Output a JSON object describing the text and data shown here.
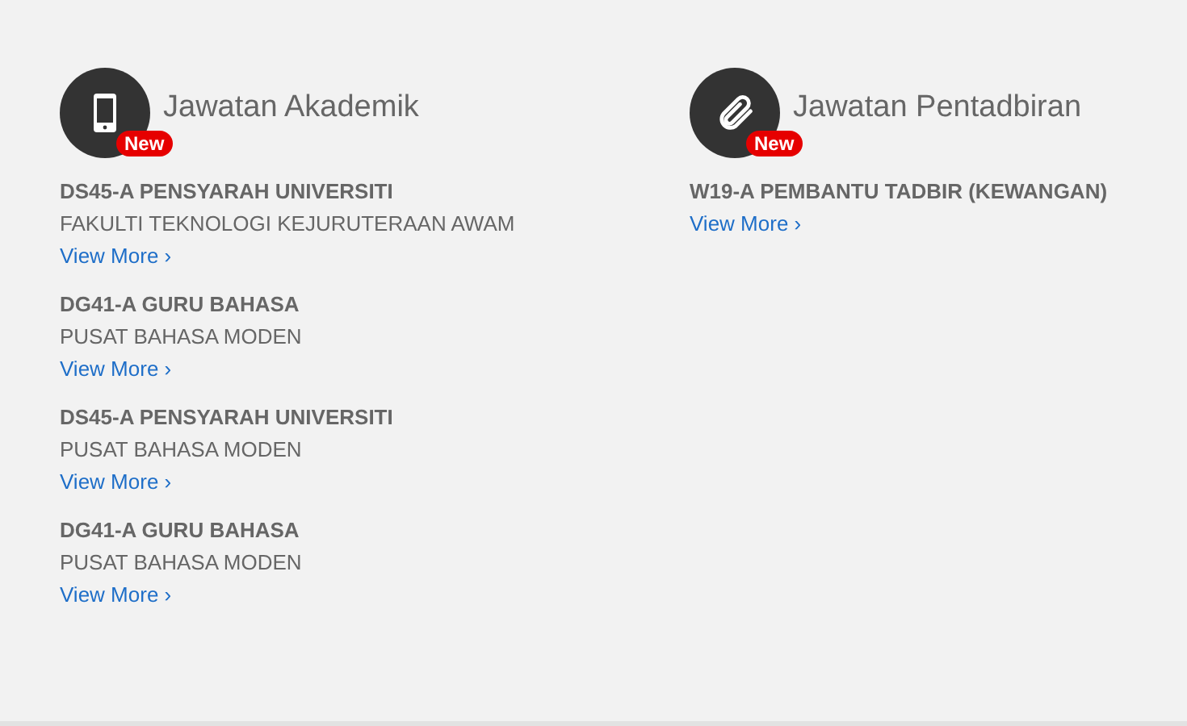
{
  "sections": [
    {
      "title": "Jawatan Akademik",
      "kind": "phone",
      "badge": "New",
      "jobs": [
        {
          "title": "DS45-A PENSYARAH UNIVERSITI",
          "department": "FAKULTI TEKNOLOGI KEJURUTERAAN AWAM",
          "link": "View More ›"
        },
        {
          "title": "DG41-A GURU BAHASA",
          "department": "PUSAT BAHASA MODEN",
          "link": "View More ›"
        },
        {
          "title": "DS45-A PENSYARAH UNIVERSITI",
          "department": "PUSAT BAHASA MODEN",
          "link": "View More ›"
        },
        {
          "title": "DG41-A GURU BAHASA",
          "department": "PUSAT BAHASA MODEN",
          "link": "View More ›"
        }
      ]
    },
    {
      "title": "Jawatan Pentadbiran",
      "kind": "paperclip",
      "badge": "New",
      "jobs": [
        {
          "title": "W19-A PEMBANTU TADBIR (KEWANGAN)",
          "link": "View More ›"
        }
      ]
    }
  ]
}
